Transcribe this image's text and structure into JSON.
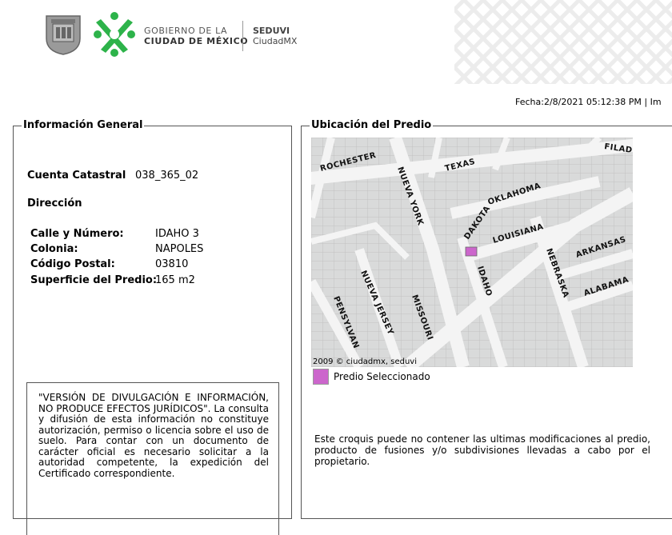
{
  "header": {
    "gov_line1": "GOBIERNO DE LA",
    "gov_line2": "CIUDAD DE MÉXICO",
    "agency": "SEDUVI",
    "agency_sub": "CiudadMX"
  },
  "fecha": "Fecha:2/8/2021 05:12:38 PM | Im",
  "info": {
    "legend": "Información General",
    "cuenta_label": "Cuenta Catastral",
    "cuenta_value": "038_365_02",
    "direccion_label": "Dirección",
    "calle_label": "Calle y Número:",
    "calle_value": "IDAHO 3",
    "colonia_label": "Colonia:",
    "colonia_value": "NAPOLES",
    "cp_label": "Código Postal:",
    "cp_value": "03810",
    "superficie_label": "Superficie del Predio:",
    "superficie_value": "165 m2",
    "disclaimer": "\"VERSIÓN DE DIVULGACIÓN E INFORMACIÓN, NO PRODUCE EFECTOS JURÍDICOS\". La consulta y difusión de esta información no constituye autorización, permiso o licencia sobre el uso de suelo. Para contar con un documento de carácter oficial es necesario solicitar a la autoridad competente, la expedición del Certificado correspondiente."
  },
  "ubicacion": {
    "legend": "Ubicación del Predio",
    "map_credit": "2009 © ciudadmx, seduvi",
    "streets": [
      "ROCHESTER",
      "TEXAS",
      "FILADE",
      "NUEVA YORK",
      "DAKOTA",
      "OKLAHOMA",
      "LOUISIANA",
      "NEBRASKA",
      "ARKANSAS",
      "ALABAMA",
      "IDAHO",
      "NUEVA JERSEY",
      "MISSOURI",
      "PENSYLVAN"
    ],
    "legend_label": "Predio Seleccionado",
    "note": "Este croquis puede no contener las ultimas modificaciones al predio, producto de fusiones y/o subdivisiones llevadas a cabo por el propietario.",
    "colors": {
      "selected": "#cc66cc",
      "map_bg": "#d9dada",
      "street": "#f4f4f4"
    }
  }
}
